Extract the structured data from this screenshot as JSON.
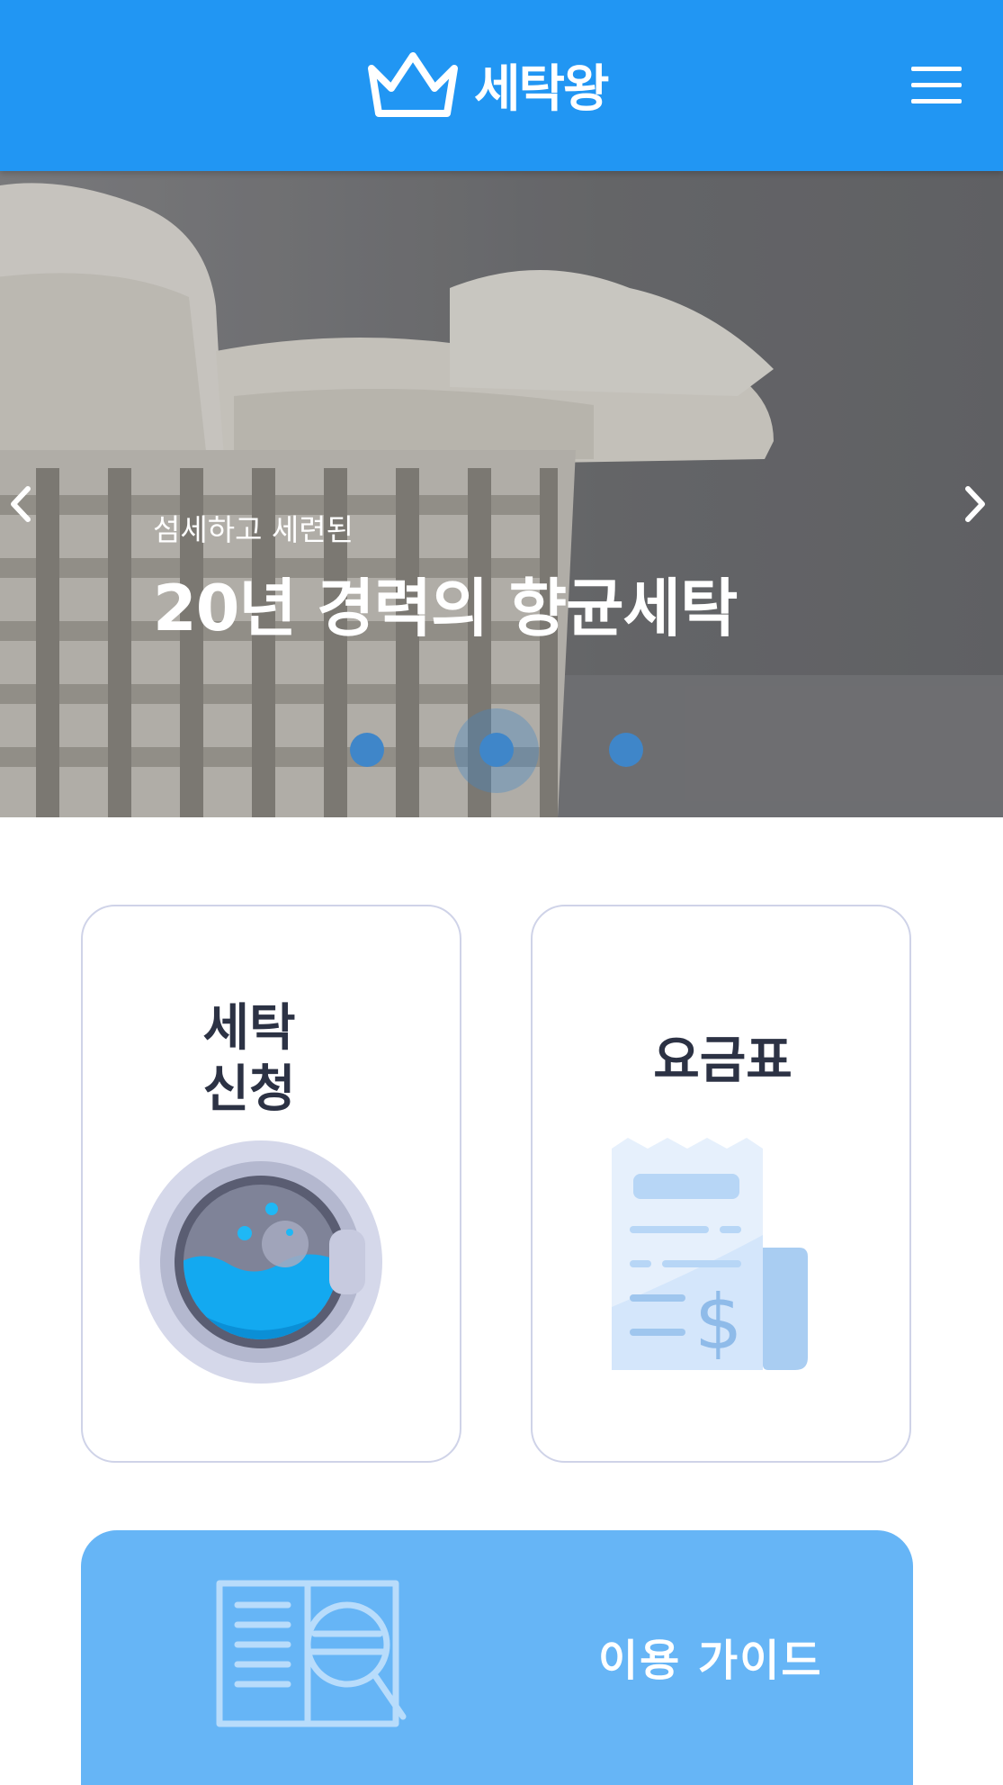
{
  "header": {
    "brand_name": "세탁왕",
    "brand_color": "#2196f3",
    "logo_icon": "crown-icon",
    "menu_icon": "hamburger-menu-icon"
  },
  "hero": {
    "subtitle": "섬세하고 세련된",
    "title": "20년 경력의 향균세탁",
    "prev_icon": "chevron-left-icon",
    "next_icon": "chevron-right-icon",
    "slide_count": 3,
    "active_slide": 2
  },
  "cards": {
    "laundry_request": {
      "line1": "세탁",
      "line2": "신청",
      "icon": "washing-machine-icon"
    },
    "price_list": {
      "label": "요금표",
      "icon": "receipt-dollar-icon"
    }
  },
  "guide": {
    "label": "이용 가이드",
    "icon": "book-magnifier-icon",
    "color": "#66b5f6"
  }
}
